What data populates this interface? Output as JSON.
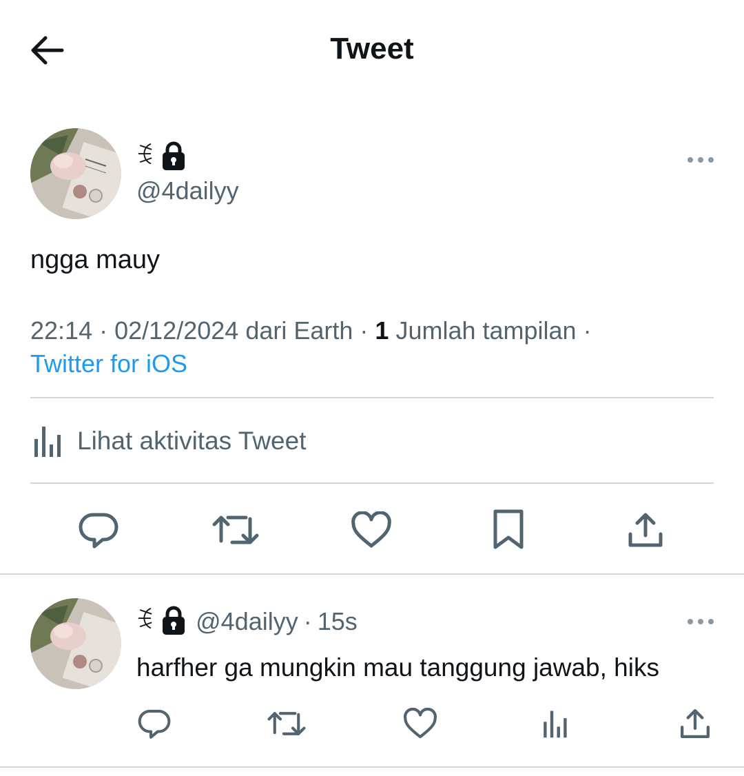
{
  "header": {
    "title": "Tweet"
  },
  "tweet": {
    "display_name": "ꉂ",
    "handle": "@4dailyy",
    "text": "ngga mauy",
    "time": "22:14",
    "date": "02/12/2024",
    "location": "dari Earth",
    "views_count": "1",
    "views_label": "Jumlah tampilan",
    "source": "Twitter for iOS",
    "activity_label": "Lihat aktivitas Tweet"
  },
  "reply": {
    "display_name": "ꉂ",
    "handle": "@4dailyy",
    "age": "15s",
    "text": "harfher ga mungkin mau tanggung jawab, hiks"
  },
  "icons": {
    "back": "arrow-left-icon",
    "lock": "lock-icon",
    "more": "more-horizontal-icon",
    "reply": "reply-icon",
    "retweet": "retweet-icon",
    "like": "heart-icon",
    "bookmark": "bookmark-icon",
    "share": "share-icon",
    "analytics": "analytics-icon"
  },
  "colors": {
    "text_primary": "#0f1419",
    "text_secondary": "#536471",
    "link": "#1d9bf0",
    "divider": "#cfd9de"
  }
}
